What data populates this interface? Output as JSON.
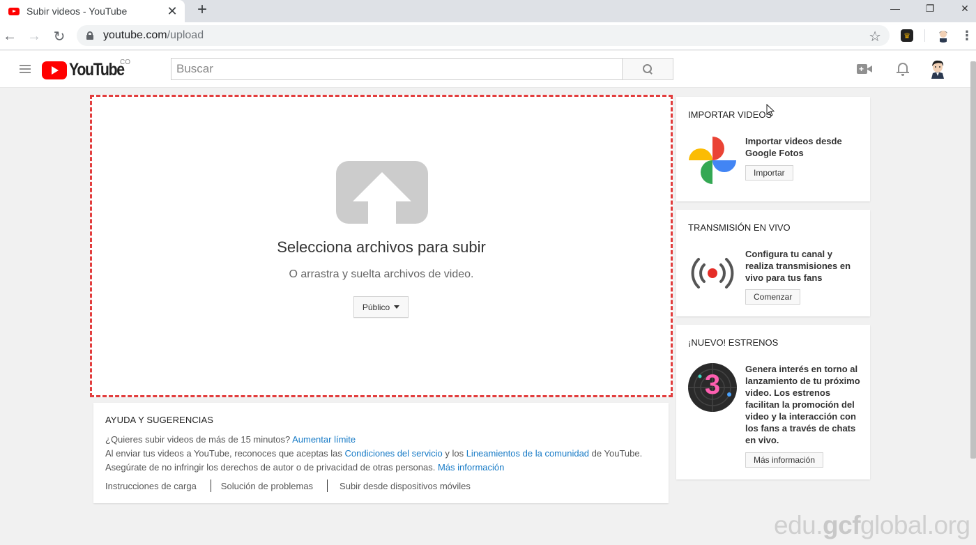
{
  "browser": {
    "tab_title": "Subir videos - YouTube",
    "tab_close": "✕",
    "new_tab": "+",
    "url_host": "youtube.com",
    "url_path": "/upload",
    "minimize": "—",
    "restore": "❐",
    "close": "✕",
    "back": "←",
    "forward": "→",
    "reload": "↻",
    "star": "☆",
    "menu": "⋮"
  },
  "header": {
    "logo_text": "YouTube",
    "country": "CO",
    "search_placeholder": "Buscar"
  },
  "upload": {
    "title": "Selecciona archivos para subir",
    "subtitle": "O arrastra y suelta archivos de video.",
    "privacy_value": "Público"
  },
  "help": {
    "title": "AYUDA Y SUGERENCIAS",
    "line1_text": "¿Quieres subir videos de más de 15 minutos?",
    "line1_link": "Aumentar límite",
    "line2_pre": "Al enviar tus videos a YouTube, reconoces que aceptas las",
    "line2_link1": "Condiciones del servicio",
    "line2_mid": "y los",
    "line2_link2": "Lineamientos de la comunidad",
    "line2_post": "de YouTube.",
    "line3_text": "Asegúrate de no infringir los derechos de autor o de privacidad de otras personas.",
    "line3_link": "Más información",
    "links": [
      "Instrucciones de carga",
      "Solución de problemas",
      "Subir desde dispositivos móviles"
    ]
  },
  "cards": {
    "import": {
      "title": "IMPORTAR VIDEOS",
      "text": "Importar videos desde Google Fotos",
      "button": "Importar"
    },
    "live": {
      "title": "TRANSMISIÓN EN VIVO",
      "text": "Configura tu canal y realiza transmisiones en vivo para tus fans",
      "button": "Comenzar"
    },
    "premieres": {
      "title": "¡NUEVO! ESTRENOS",
      "text": "Genera interés en torno al lanzamiento de tu próximo video. Los estrenos facilitan la promoción del video y la interacción con los fans a través de chats en vivo.",
      "badge": "3",
      "button": "Más información"
    }
  },
  "watermark": {
    "part1": "edu.",
    "part2": "gcf",
    "part3": "global.org"
  },
  "colors": {
    "brand_red": "#ff0000",
    "dashed_border": "#e23d3d",
    "link": "#167ac6"
  }
}
